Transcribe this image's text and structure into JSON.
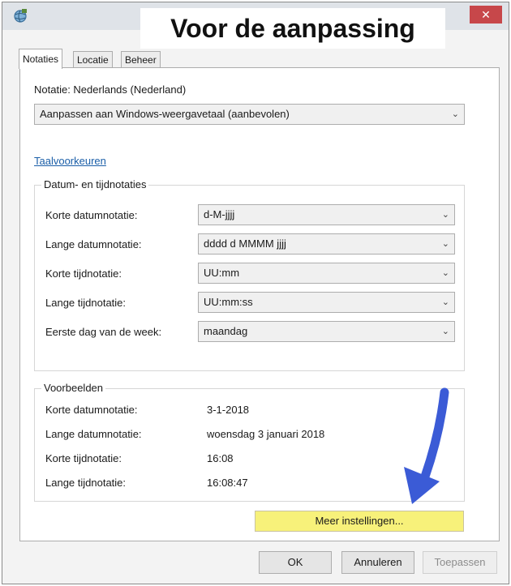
{
  "window": {
    "close_symbol": "✕"
  },
  "banner": {
    "text": "Voor de aanpassing"
  },
  "tabs": [
    {
      "label": "Notaties"
    },
    {
      "label": "Locatie"
    },
    {
      "label": "Beheer"
    }
  ],
  "notation": {
    "label": "Notatie: Nederlands (Nederland)",
    "select_value": "Aanpassen aan Windows-weergavetaal (aanbevolen)"
  },
  "language_prefs_link": "Taalvoorkeuren",
  "formats_group": {
    "title": "Datum- en tijdnotaties",
    "rows": [
      {
        "label": "Korte datumnotatie:",
        "value": "d-M-jjjj"
      },
      {
        "label": "Lange datumnotatie:",
        "value": "dddd d MMMM jjjj"
      },
      {
        "label": "Korte tijdnotatie:",
        "value": "UU:mm"
      },
      {
        "label": "Lange tijdnotatie:",
        "value": "UU:mm:ss"
      },
      {
        "label": "Eerste dag van de week:",
        "value": "maandag"
      }
    ]
  },
  "examples_group": {
    "title": "Voorbeelden",
    "rows": [
      {
        "label": "Korte datumnotatie:",
        "value": "3-1-2018"
      },
      {
        "label": "Lange datumnotatie:",
        "value": "woensdag 3 januari 2018"
      },
      {
        "label": "Korte tijdnotatie:",
        "value": "16:08"
      },
      {
        "label": "Lange tijdnotatie:",
        "value": "16:08:47"
      }
    ]
  },
  "more_settings_label": "Meer instellingen...",
  "buttons": {
    "ok": "OK",
    "cancel": "Annuleren",
    "apply": "Toepassen"
  },
  "colors": {
    "highlight": "#f7f17a",
    "arrow": "#3b5bd6",
    "close": "#c7474a",
    "link": "#1a5ea8"
  },
  "icons": {
    "app": "region-globe-icon",
    "close": "close-icon",
    "chevron": "chevron-down-icon",
    "annotation": "blue-arrow-icon"
  }
}
